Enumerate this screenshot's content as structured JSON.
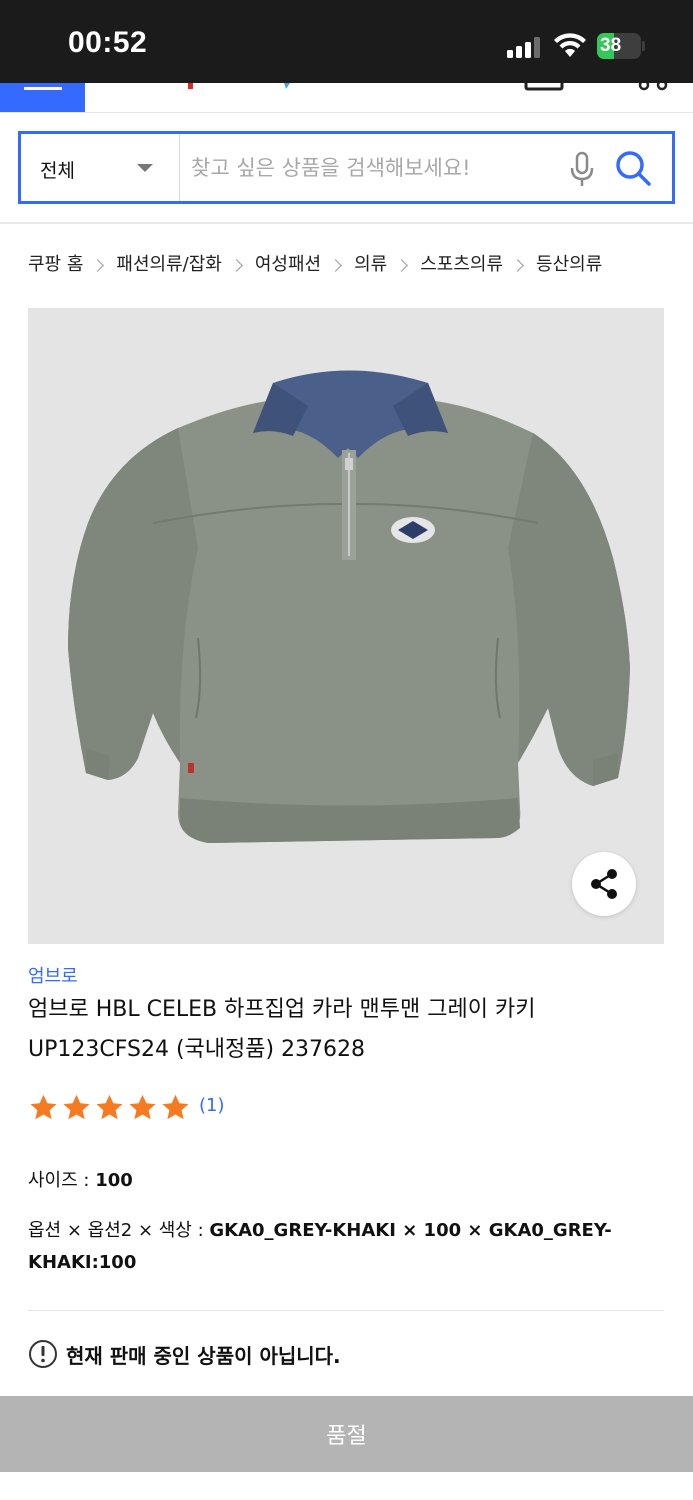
{
  "status_bar": {
    "time": "00:52",
    "battery_level": "38",
    "battery_percent": 38
  },
  "colors": {
    "accent": "#346aff",
    "star": "#f57b22",
    "soldout_bg": "#b4b4b4",
    "image_bg": "#e4e4e4"
  },
  "search": {
    "category": "전체",
    "placeholder": "찾고 싶은 상품을 검색해보세요!",
    "value": ""
  },
  "breadcrumb": [
    "쿠팡 홈",
    "패션의류/잡화",
    "여성패션",
    "의류",
    "스포츠의류",
    "등산의류"
  ],
  "product": {
    "image_icon": "sweatshirt-photo",
    "brand": "엄브로",
    "title": "엄브로 HBL CELEB 하프집업 카라 맨투맨 그레이 카키 UP123CFS24 (국내정품) 237628",
    "rating_stars": 5,
    "review_count": "(1)",
    "size_label": "사이즈 : ",
    "size_value": "100",
    "options_label": "옵션 × 옵션2 × 색상 : ",
    "options_value": "GKA0_GREY-KHAKI × 100 × GKA0_GREY-KHAKI:100",
    "notice": "현재 판매 중인 상품이 아닙니다.",
    "soldout_button": "품절"
  }
}
